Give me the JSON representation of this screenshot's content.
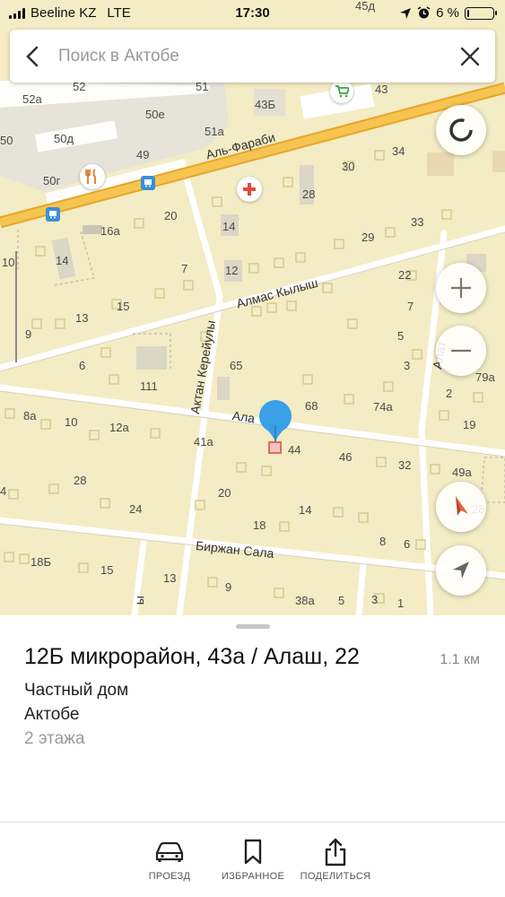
{
  "status_bar": {
    "carrier": "Beeline KZ",
    "network": "LTE",
    "time": "17:30",
    "battery": "6 %",
    "battery_level": 0.06
  },
  "search": {
    "placeholder": "Поиск в Актобе"
  },
  "map": {
    "streets": [
      "Аль-Фараби",
      "Алмас Кылыш",
      "Актан Керейулы",
      "Ала",
      "Биржан Сала",
      "ы",
      "Алат"
    ],
    "building_numbers": [
      "45д",
      "52",
      "51",
      "43",
      "52а",
      "43Б",
      "50е",
      "51а",
      "34",
      "50",
      "50д",
      "49",
      "30",
      "50г",
      "28",
      "20",
      "16а",
      "14",
      "33",
      "10",
      "14",
      "29",
      "12",
      "7",
      "22",
      "13",
      "15",
      "7",
      "9",
      "6",
      "65",
      "5",
      "111",
      "3",
      "79а",
      "68",
      "74а",
      "2",
      "8а",
      "10",
      "12а",
      "41а",
      "44",
      "46",
      "32",
      "19",
      "49а",
      "28",
      "20",
      "24",
      "14",
      "18",
      "28",
      "8",
      "6",
      "4",
      "18Б",
      "15",
      "13",
      "9",
      "38а",
      "5",
      "3",
      "1"
    ]
  },
  "sheet": {
    "title": "12Б микрорайон, 43а / Алаш, 22",
    "distance": "1.1 км",
    "type": "Частный дом",
    "city": "Актобе",
    "floors": "2 этажа"
  },
  "tabs": [
    {
      "label": "ПРОЕЗД",
      "icon": "car-icon"
    },
    {
      "label": "ИЗБРАННОЕ",
      "icon": "bookmark-icon"
    },
    {
      "label": "ПОДЕЛИТЬСЯ",
      "icon": "share-icon"
    }
  ],
  "colors": {
    "map_bg": "#f3ecc5",
    "main_road": "#f3b83a",
    "pin": "#3aa0e8",
    "compass": "#e8623a"
  }
}
